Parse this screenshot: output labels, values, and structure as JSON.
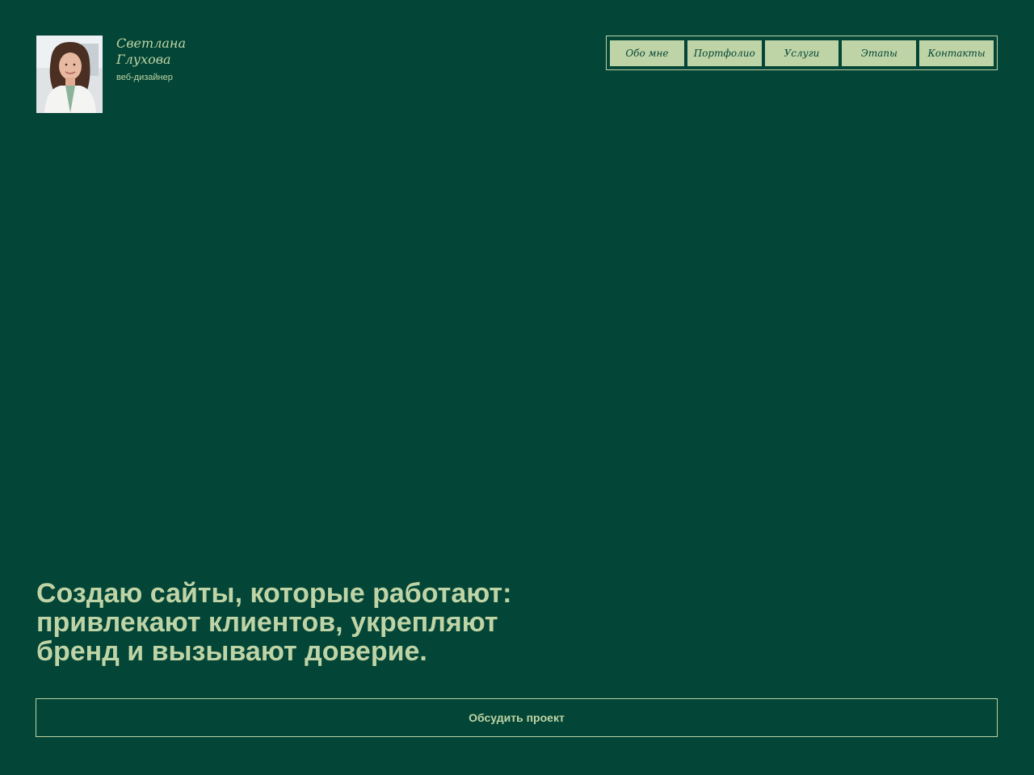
{
  "profile": {
    "name": "Светлана Глухова",
    "role": "веб-дизайнер"
  },
  "nav": {
    "items": [
      "Обо мне",
      "Портфолио",
      "Услуги",
      "Этапы",
      "Контакты"
    ]
  },
  "hero": {
    "title_lines": [
      "Создаю сайты, которые работают:",
      "привлекают клиентов, укрепляют",
      "бренд и вызывают доверие."
    ],
    "cta_label": "Обсудить проект"
  },
  "colors": {
    "background": "#034536",
    "accent": "#bfd4a6"
  }
}
